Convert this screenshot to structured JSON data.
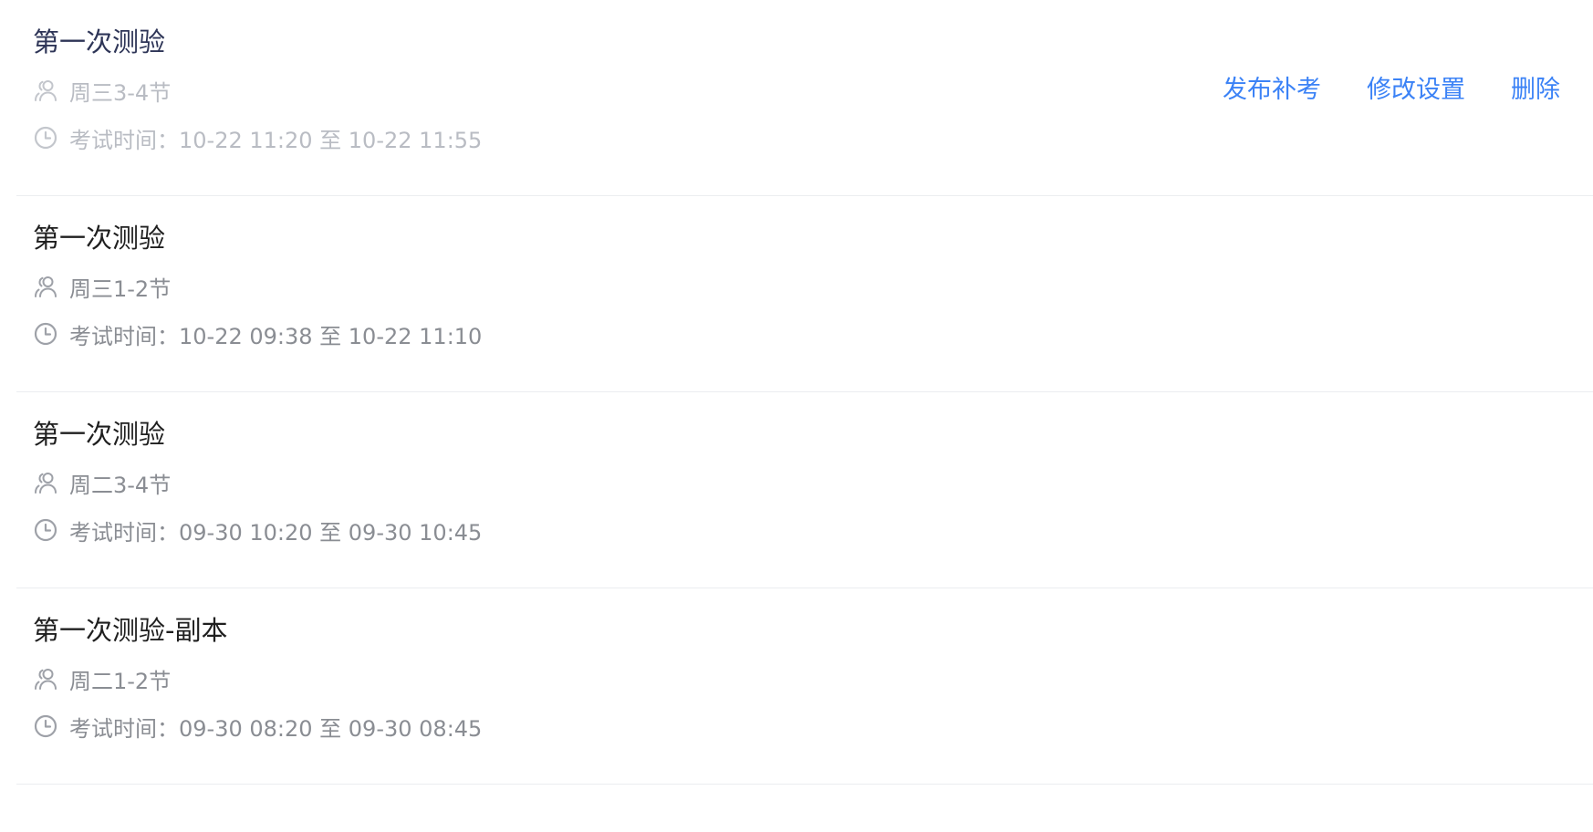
{
  "actions": {
    "publish_makeup": "发布补考",
    "edit_settings": "修改设置",
    "delete": "删除"
  },
  "exams": [
    {
      "title": "第一次测验",
      "class_group": "周三3-4节",
      "time_label": "考试时间：",
      "time_range": "10-22 11:20 至 10-22 11:55"
    },
    {
      "title": "第一次测验",
      "class_group": "周三1-2节",
      "time_label": "考试时间：",
      "time_range": "10-22 09:38 至 10-22 11:10"
    },
    {
      "title": "第一次测验",
      "class_group": "周二3-4节",
      "time_label": "考试时间：",
      "time_range": "09-30 10:20 至 09-30 10:45"
    },
    {
      "title": "第一次测验-副本",
      "class_group": "周二1-2节",
      "time_label": "考试时间：",
      "time_range": "09-30 08:20 至 09-30 08:45"
    }
  ],
  "icons": {
    "group": "users-icon",
    "time": "clock-icon"
  },
  "colors": {
    "accent": "#3b82f6",
    "title_text": "#1f1f1f",
    "meta_text": "#8a8d93",
    "divider": "#ebedf0"
  }
}
